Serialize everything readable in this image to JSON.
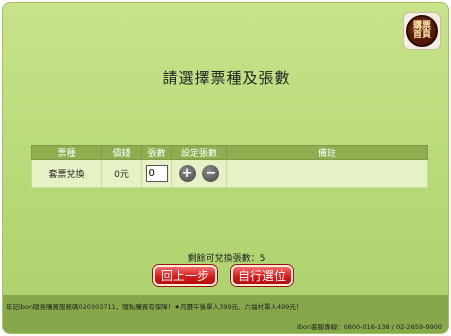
{
  "home_button": {
    "line1": "購票",
    "line2": "首頁"
  },
  "title": "請選擇票種及張數",
  "table": {
    "headers": [
      "票種",
      "價錢",
      "張數",
      "設定張數",
      "備註"
    ],
    "rows": [
      {
        "ticket_type": "套票兌換",
        "price": "0元",
        "quantity": "0",
        "note": ""
      }
    ],
    "plus_symbol": "+",
    "minus_symbol": "−"
  },
  "remaining_text": "剩餘可兌換張數：5",
  "buttons": {
    "back": "回上一步",
    "self_select": "自行選位"
  },
  "footer": {
    "notice": "年記ibon隨身購買服務碼020303711，隨私購買有保障！★月曆午後單人399元、六福村單人499元！",
    "service": "ibon客服專線：0800-016-138 / 02-2659-9900"
  }
}
